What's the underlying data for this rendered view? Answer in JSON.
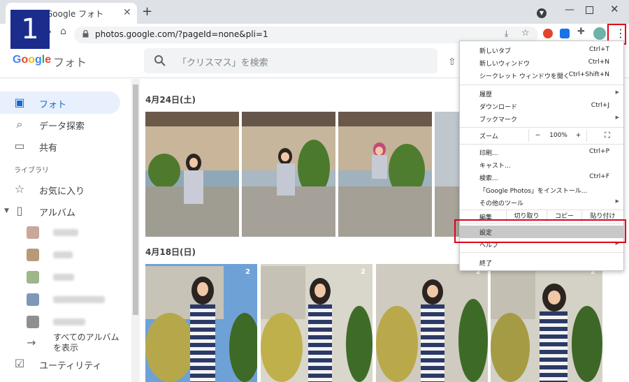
{
  "step_badge": "1",
  "browser": {
    "tab_title": "Google フォト",
    "url": "photos.google.com/?pageId=none&pli=1"
  },
  "header": {
    "logo_g": "Google",
    "logo_product": "フォト",
    "search_placeholder": "「クリスマス」を検索"
  },
  "sidebar": {
    "items": [
      {
        "label": "フォト",
        "icon": "photo-icon"
      },
      {
        "label": "データ探索",
        "icon": "search-icon"
      },
      {
        "label": "共有",
        "icon": "chat-icon"
      }
    ],
    "library_label": "ライブラリ",
    "library_items": [
      {
        "label": "お気に入り",
        "icon": "star-icon"
      },
      {
        "label": "アルバム",
        "icon": "album-icon"
      }
    ],
    "all_albums_label": "すべてのアルバムを表示",
    "utility_label": "ユーティリティ"
  },
  "content": {
    "sections": [
      {
        "date": "4月24日(土)"
      },
      {
        "date": "4月18日(日)",
        "badge": "2"
      }
    ]
  },
  "chrome_menu": {
    "new_tab": {
      "label": "新しいタブ",
      "shortcut": "Ctrl+T"
    },
    "new_window": {
      "label": "新しいウィンドウ",
      "shortcut": "Ctrl+N"
    },
    "incognito": {
      "label": "シークレット ウィンドウを開く",
      "shortcut": "Ctrl+Shift+N"
    },
    "history": {
      "label": "履歴"
    },
    "downloads": {
      "label": "ダウンロード",
      "shortcut": "Ctrl+J"
    },
    "bookmarks": {
      "label": "ブックマーク"
    },
    "zoom": {
      "label": "ズーム",
      "minus": "−",
      "value": "100%",
      "plus": "+"
    },
    "print": {
      "label": "印刷...",
      "shortcut": "Ctrl+P"
    },
    "cast": {
      "label": "キャスト..."
    },
    "find": {
      "label": "検索...",
      "shortcut": "Ctrl+F"
    },
    "install": {
      "label": "「Google Photos」をインストール..."
    },
    "more_tools": {
      "label": "その他のツール"
    },
    "edit": {
      "label": "編集",
      "cut": "切り取り",
      "copy": "コピー",
      "paste": "貼り付け"
    },
    "settings": {
      "label": "設定"
    },
    "help": {
      "label": "ヘルプ"
    },
    "exit": {
      "label": "終了"
    }
  },
  "colors": {
    "highlight_red": "#e0001a",
    "badge_blue": "#1c2c8c",
    "active_nav": "#e8f0fe"
  }
}
